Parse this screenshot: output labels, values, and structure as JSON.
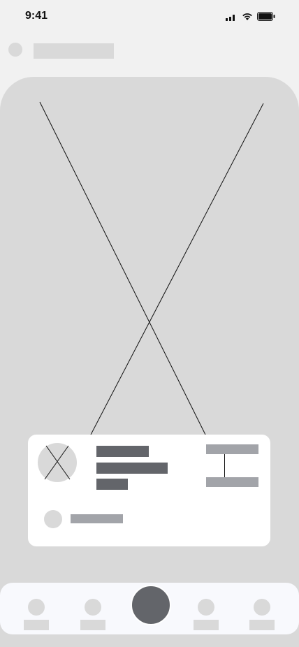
{
  "status_bar": {
    "time": "9:41",
    "icons": [
      "cellular-signal-icon",
      "wifi-icon",
      "battery-icon"
    ]
  },
  "header": {
    "avatar_icon": "avatar-placeholder",
    "title": ""
  },
  "main": {
    "media_icon": "image-placeholder-icon"
  },
  "info_card": {
    "thumbnail_icon": "image-placeholder-icon",
    "text_lines": [
      "",
      "",
      ""
    ],
    "route": {
      "start_icon": "route-start-icon",
      "end_icon": "route-end-icon",
      "start_label": "",
      "end_label": ""
    },
    "user_label": ""
  },
  "tab_bar": {
    "items": [
      {
        "label": ""
      },
      {
        "label": ""
      },
      {
        "label": ""
      },
      {
        "label": ""
      }
    ],
    "center_action_icon": "primary-action-icon"
  },
  "colors": {
    "background": "#f1f1f1",
    "placeholder": "#d9d9d9",
    "dark_block": "#63656a",
    "light_block": "#a2a4a9",
    "card": "#ffffff",
    "tab_bar": "#f8f9fd"
  }
}
